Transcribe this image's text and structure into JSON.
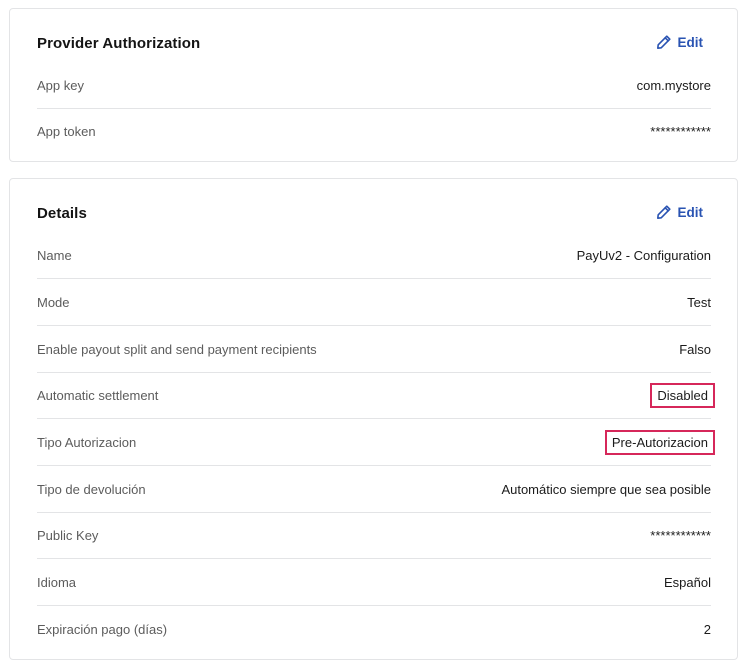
{
  "provider_authorization": {
    "title": "Provider Authorization",
    "edit_label": "Edit",
    "rows": [
      {
        "label": "App key",
        "value": "com.mystore"
      },
      {
        "label": "App token",
        "value": "************"
      }
    ]
  },
  "details": {
    "title": "Details",
    "edit_label": "Edit",
    "rows": [
      {
        "label": "Name",
        "value": "PayUv2 - Configuration"
      },
      {
        "label": "Mode",
        "value": "Test"
      },
      {
        "label": "Enable payout split and send payment recipients",
        "value": "Falso"
      },
      {
        "label": "Automatic settlement",
        "value": "Disabled",
        "highlighted": true
      },
      {
        "label": "Tipo Autorizacion",
        "value": "Pre-Autorizacion",
        "highlighted": true
      },
      {
        "label": "Tipo de devolución",
        "value": "Automático siempre que sea posible"
      },
      {
        "label": "Public Key",
        "value": "************"
      },
      {
        "label": "Idioma",
        "value": "Español"
      },
      {
        "label": "Expiración pago (días)",
        "value": "2"
      }
    ]
  },
  "colors": {
    "accent": "#2953b2",
    "highlight_border": "#d6275a",
    "divider": "#e3e4e6"
  },
  "icons": {
    "edit": "pencil-icon"
  }
}
